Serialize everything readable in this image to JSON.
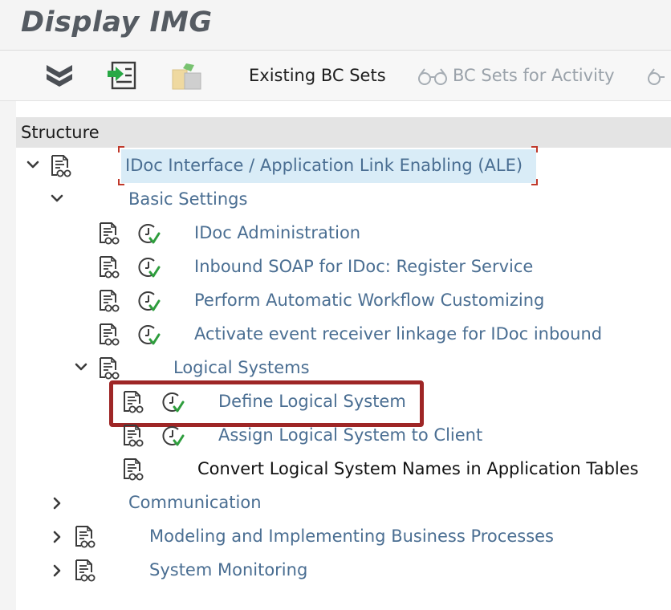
{
  "window": {
    "title": "Display IMG"
  },
  "toolbar": {
    "expand_icon": "double-chevron-down-icon",
    "execute_icon": "execute-activity-icon",
    "doc_icon": "document-folder-icon",
    "existing_bc_sets": "Existing BC Sets",
    "bc_sets_for_activity": "BC Sets for Activity"
  },
  "structure": {
    "header": "Structure",
    "root": {
      "label": "IDoc Interface / Application Link Enabling (ALE)"
    },
    "basic_settings": {
      "label": "Basic Settings"
    },
    "items": [
      {
        "label": "IDoc Administration"
      },
      {
        "label": "Inbound SOAP for IDoc: Register Service"
      },
      {
        "label": "Perform Automatic Workflow Customizing"
      },
      {
        "label": "Activate event receiver linkage for IDoc inbound"
      }
    ],
    "logical_systems": {
      "label": "Logical Systems"
    },
    "logical_items": [
      {
        "label": "Define Logical System"
      },
      {
        "label": "Assign Logical System to Client"
      },
      {
        "label": "Convert Logical System Names in Application Tables"
      }
    ],
    "communication": {
      "label": "Communication"
    },
    "modeling": {
      "label": "Modeling and Implementing Business Processes"
    },
    "monitoring": {
      "label": "System Monitoring"
    }
  },
  "colors": {
    "link": "#4a6e92",
    "selection": "#d9ecf7",
    "highlight_border": "#9e2626",
    "check_green": "#2e9d3d"
  }
}
